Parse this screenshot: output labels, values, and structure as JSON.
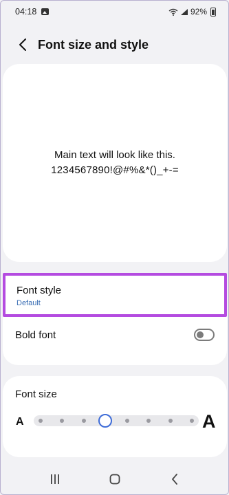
{
  "status_bar": {
    "time": "04:18",
    "battery": "92%"
  },
  "header": {
    "title": "Font size and style"
  },
  "preview": {
    "line1": "Main text will look like this.",
    "line2": "1234567890!@#%&*()_+-="
  },
  "settings": {
    "font_style_label": "Font style",
    "font_style_value": "Default",
    "bold_font_label": "Bold font",
    "bold_font_enabled": false
  },
  "font_size": {
    "title": "Font size",
    "small_label": "A",
    "large_label": "A",
    "steps": 8,
    "current_step": 3
  },
  "colors": {
    "highlight": "#b44be0",
    "accent": "#3e6cd8",
    "subtext": "#3b6fb5"
  },
  "icons": {
    "back": "chevron-left-icon",
    "recents": "recents-icon",
    "home": "home-icon",
    "nav_back": "nav-back-icon"
  }
}
